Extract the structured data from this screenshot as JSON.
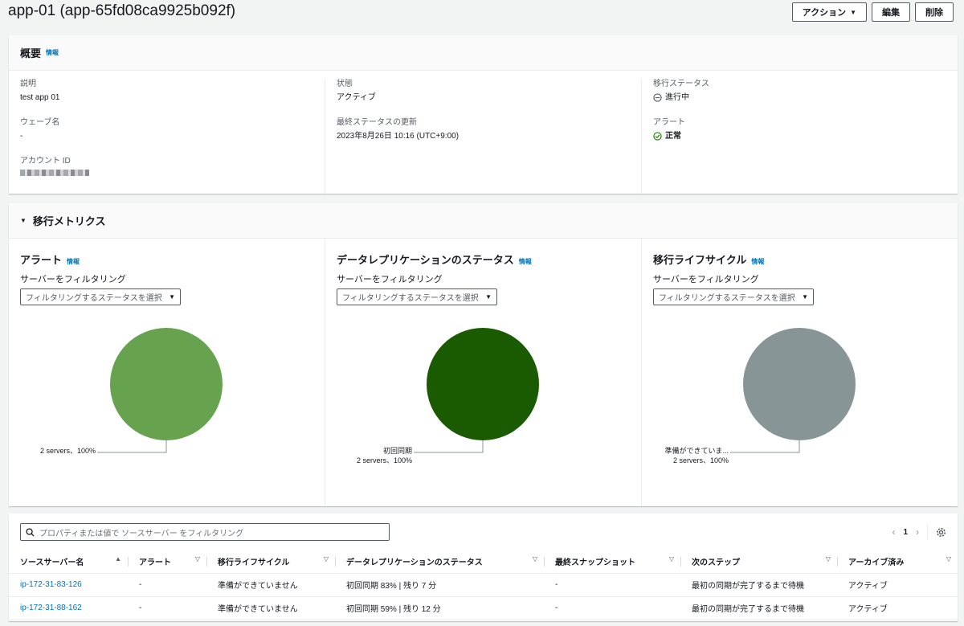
{
  "header": {
    "title": "app-01 (app-65fd08ca9925b092f)",
    "actions_label": "アクション",
    "edit_label": "編集",
    "delete_label": "削除"
  },
  "overview": {
    "title": "概要",
    "info": "情報",
    "description_label": "説明",
    "description_value": "test app 01",
    "wave_label": "ウェーブ名",
    "wave_value": "-",
    "account_label": "アカウント ID",
    "state_label": "状態",
    "state_value": "アクティブ",
    "last_update_label": "最終ステータスの更新",
    "last_update_value": "2023年8月26日 10:16 (UTC+9:00)",
    "migration_status_label": "移行ステータス",
    "migration_status_value": "進行中",
    "alert_label": "アラート",
    "alert_value": "正常"
  },
  "metrics": {
    "title": "移行メトリクス",
    "info": "情報",
    "filter_label": "サーバーをフィルタリング",
    "filter_placeholder": "フィルタリングするステータスを選択",
    "charts": [
      {
        "title": "アラート",
        "color": "#67a24f",
        "slice_label": "",
        "count_label": "2 servers、100%"
      },
      {
        "title": "データレプリケーションのステータス",
        "color": "#1a5a00",
        "slice_label": "初回同期",
        "count_label": "2 servers、100%"
      },
      {
        "title": "移行ライフサイクル",
        "color": "#879596",
        "slice_label": "準備ができていま...",
        "count_label": "2 servers、100%"
      }
    ]
  },
  "chart_data": [
    {
      "type": "pie",
      "title": "アラート",
      "slices": [
        {
          "label": "",
          "value": 100,
          "servers": 2
        }
      ]
    },
    {
      "type": "pie",
      "title": "データレプリケーションのステータス",
      "slices": [
        {
          "label": "初回同期",
          "value": 100,
          "servers": 2
        }
      ]
    },
    {
      "type": "pie",
      "title": "移行ライフサイクル",
      "slices": [
        {
          "label": "準備ができていま...",
          "value": 100,
          "servers": 2
        }
      ]
    }
  ],
  "table": {
    "search_placeholder": "プロパティまたは値で ソースサーバー をフィルタリング",
    "page": "1",
    "columns": [
      "ソースサーバー名",
      "アラート",
      "移行ライフサイクル",
      "データレプリケーションのステータス",
      "最終スナップショット",
      "次のステップ",
      "アーカイブ済み"
    ],
    "rows": [
      [
        "ip-172-31-83-126",
        "-",
        "準備ができていません",
        "初回同期 83% | 残り 7 分",
        "-",
        "最初の同期が完了するまで待機",
        "アクティブ"
      ],
      [
        "ip-172-31-88-162",
        "-",
        "準備ができていません",
        "初回同期 59% | 残り 12 分",
        "-",
        "最初の同期が完了するまで待機",
        "アクティブ"
      ]
    ]
  }
}
